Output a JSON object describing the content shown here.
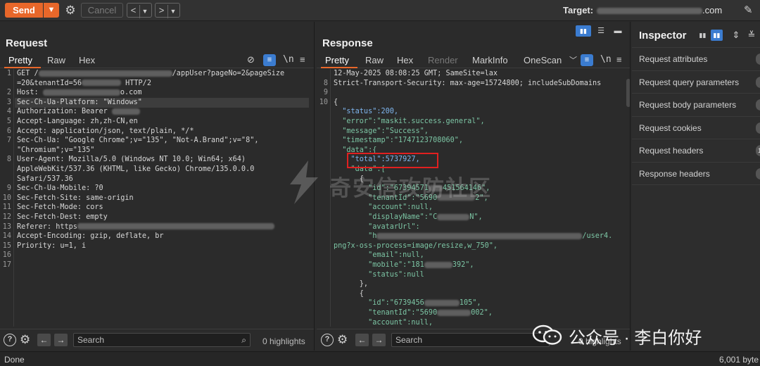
{
  "toolbar": {
    "send_label": "Send",
    "cancel_label": "Cancel",
    "target_label": "Target:",
    "target_suffix": ".com"
  },
  "request": {
    "title": "Request",
    "tabs": [
      "Pretty",
      "Raw",
      "Hex"
    ],
    "lines": [
      {
        "n": "1",
        "text": "GET /"
      },
      {
        "n": "",
        "text": "=20&tenantId=56"
      },
      {
        "n": "2",
        "text": "Host: "
      },
      {
        "n": "3",
        "text": "Sec-Ch-Ua-Platform: \"Windows\""
      },
      {
        "n": "4",
        "text": "Authorization: Bearer "
      },
      {
        "n": "5",
        "text": "Accept-Language: zh,zh-CN,en"
      },
      {
        "n": "6",
        "text": "Accept: application/json, text/plain, */*"
      },
      {
        "n": "7",
        "text": "Sec-Ch-Ua: \"Google Chrome\";v=\"135\", \"Not-A.Brand\";v=\"8\","
      },
      {
        "n": "",
        "text": "\"Chromium\";v=\"135\""
      },
      {
        "n": "8",
        "text": "User-Agent: Mozilla/5.0 (Windows NT 10.0; Win64; x64)"
      },
      {
        "n": "",
        "text": "AppleWebKit/537.36 (KHTML, like Gecko) Chrome/135.0.0.0"
      },
      {
        "n": "",
        "text": "Safari/537.36"
      },
      {
        "n": "9",
        "text": "Sec-Ch-Ua-Mobile: ?0"
      },
      {
        "n": "10",
        "text": "Sec-Fetch-Site: same-origin"
      },
      {
        "n": "11",
        "text": "Sec-Fetch-Mode: cors"
      },
      {
        "n": "12",
        "text": "Sec-Fetch-Dest: empty"
      },
      {
        "n": "13",
        "text": "Referer: https"
      },
      {
        "n": "14",
        "text": "Accept-Encoding: gzip, deflate, br"
      },
      {
        "n": "15",
        "text": "Priority: u=1, i"
      },
      {
        "n": "16",
        "text": ""
      },
      {
        "n": "17",
        "text": ""
      }
    ],
    "line1_tail": "/appUser?pageNo=2&pageSize",
    "line1b_tail": " HTTP/2",
    "line2_tail": "o.com",
    "search_placeholder": "Search",
    "highlights": "0 highlights"
  },
  "response": {
    "title": "Response",
    "tabs": [
      "Pretty",
      "Raw",
      "Hex",
      "Render",
      "MarkInfo",
      "OneScan"
    ],
    "lines": [
      {
        "n": "",
        "text": "12-May-2025 08:08:25 GMT; SameSite=lax"
      },
      {
        "n": "8",
        "text": "Strict-Transport-Security: max-age=15724800; includeSubDomains"
      },
      {
        "n": "9",
        "text": ""
      },
      {
        "n": "10",
        "text": "{"
      },
      {
        "n": "",
        "text": "  \"status\":200,"
      },
      {
        "n": "",
        "text": "  \"error\":\"maskit.success.general\","
      },
      {
        "n": "",
        "text": "  \"message\":\"Success\","
      },
      {
        "n": "",
        "text": "  \"timestamp\":\"1747123708060\","
      },
      {
        "n": "",
        "text": "  \"data\":{"
      },
      {
        "n": "",
        "text": "    \"total\":5737927,"
      },
      {
        "n": "",
        "text": "    \"data\":["
      },
      {
        "n": "",
        "text": "      {"
      },
      {
        "n": "",
        "text": "        \"id\":\"67394571"
      },
      {
        "n": "",
        "text": "        \"tenantId\":\"5690"
      },
      {
        "n": "",
        "text": "        \"account\":null,"
      },
      {
        "n": "",
        "text": "        \"displayName\":\"C"
      },
      {
        "n": "",
        "text": "        \"avatarUrl\":"
      },
      {
        "n": "",
        "text": "        \"h"
      },
      {
        "n": "",
        "text": "png?x-oss-process=image/resize,w_750\","
      },
      {
        "n": "",
        "text": "        \"email\":null,"
      },
      {
        "n": "",
        "text": "        \"mobile\":\"181"
      },
      {
        "n": "",
        "text": "        \"status\":null"
      },
      {
        "n": "",
        "text": "      },"
      },
      {
        "n": "",
        "text": "      {"
      },
      {
        "n": "",
        "text": "        \"id\":\"6739456"
      },
      {
        "n": "",
        "text": "        \"tenantId\":\"5690"
      },
      {
        "n": "",
        "text": "        \"account\":null,"
      }
    ],
    "id1_tail": "451564146\",",
    "tenant1_tail": "2\",",
    "display_tail": "N\",",
    "avatar_tail": "/user4.",
    "mobile_tail": "392\",",
    "id2_tail": "105\",",
    "tenant2_tail": "002\",",
    "search_placeholder": "Search",
    "highlights": "0 highlights"
  },
  "inspector": {
    "title": "Inspector",
    "rows": [
      "Request attributes",
      "Request query parameters",
      "Request body parameters",
      "Request cookies",
      "Request headers",
      "Response headers"
    ],
    "count_badge": "1"
  },
  "status": {
    "left": "Done",
    "right": "6,001 byte"
  },
  "watermarks": {
    "center": "奇安信攻防社区",
    "wechat": "公众号 · 李白你好"
  },
  "colors": {
    "accent": "#e8672a",
    "highlight_box": "#e02020",
    "key_blue": "#7fb6ef",
    "string_green": "#7cc5a4"
  }
}
